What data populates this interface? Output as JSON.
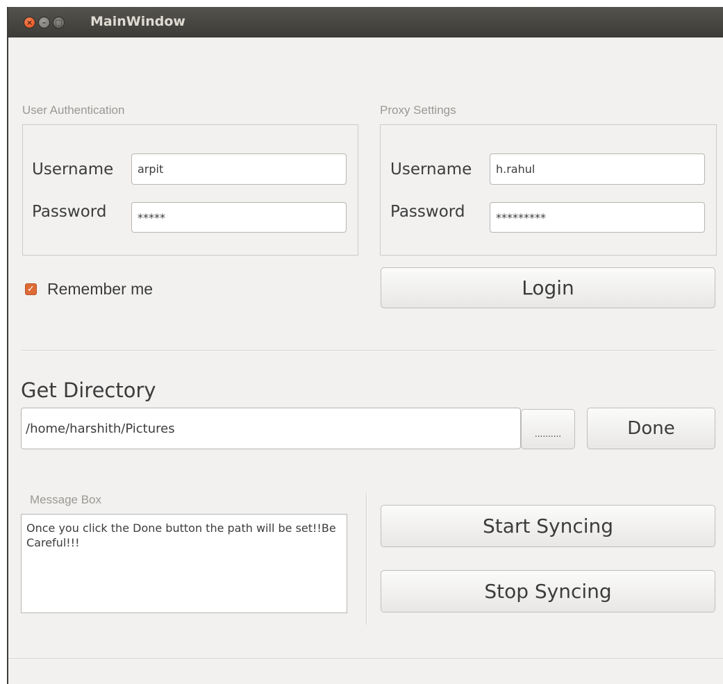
{
  "window": {
    "title": "MainWindow",
    "controls": {
      "close": "×",
      "minimize": "–",
      "maximize": "□"
    }
  },
  "user_auth": {
    "label": "User Authentication",
    "username_label": "Username",
    "username_value": "arpit",
    "password_label": "Password",
    "password_value": "*****"
  },
  "proxy": {
    "label": "Proxy Settings",
    "username_label": "Username",
    "username_value": "h.rahul",
    "password_label": "Password",
    "password_value": "*********"
  },
  "remember": {
    "label": "Remember me",
    "checked": true,
    "check_glyph": "✓"
  },
  "login": {
    "label": "Login"
  },
  "directory": {
    "heading": "Get Directory",
    "path": "/home/harshith/Pictures",
    "browse_label": "..........",
    "done_label": "Done"
  },
  "message": {
    "label": "Message Box",
    "text": "Once you click the Done button the path will be set!!Be Careful!!!"
  },
  "sync": {
    "start_label": "Start Syncing",
    "stop_label": "Stop Syncing"
  },
  "colors": {
    "accent": "#dd4814",
    "checkbox": "#de6a36",
    "titlebar": "#3c3b37",
    "window_bg": "#f2f1f0"
  }
}
